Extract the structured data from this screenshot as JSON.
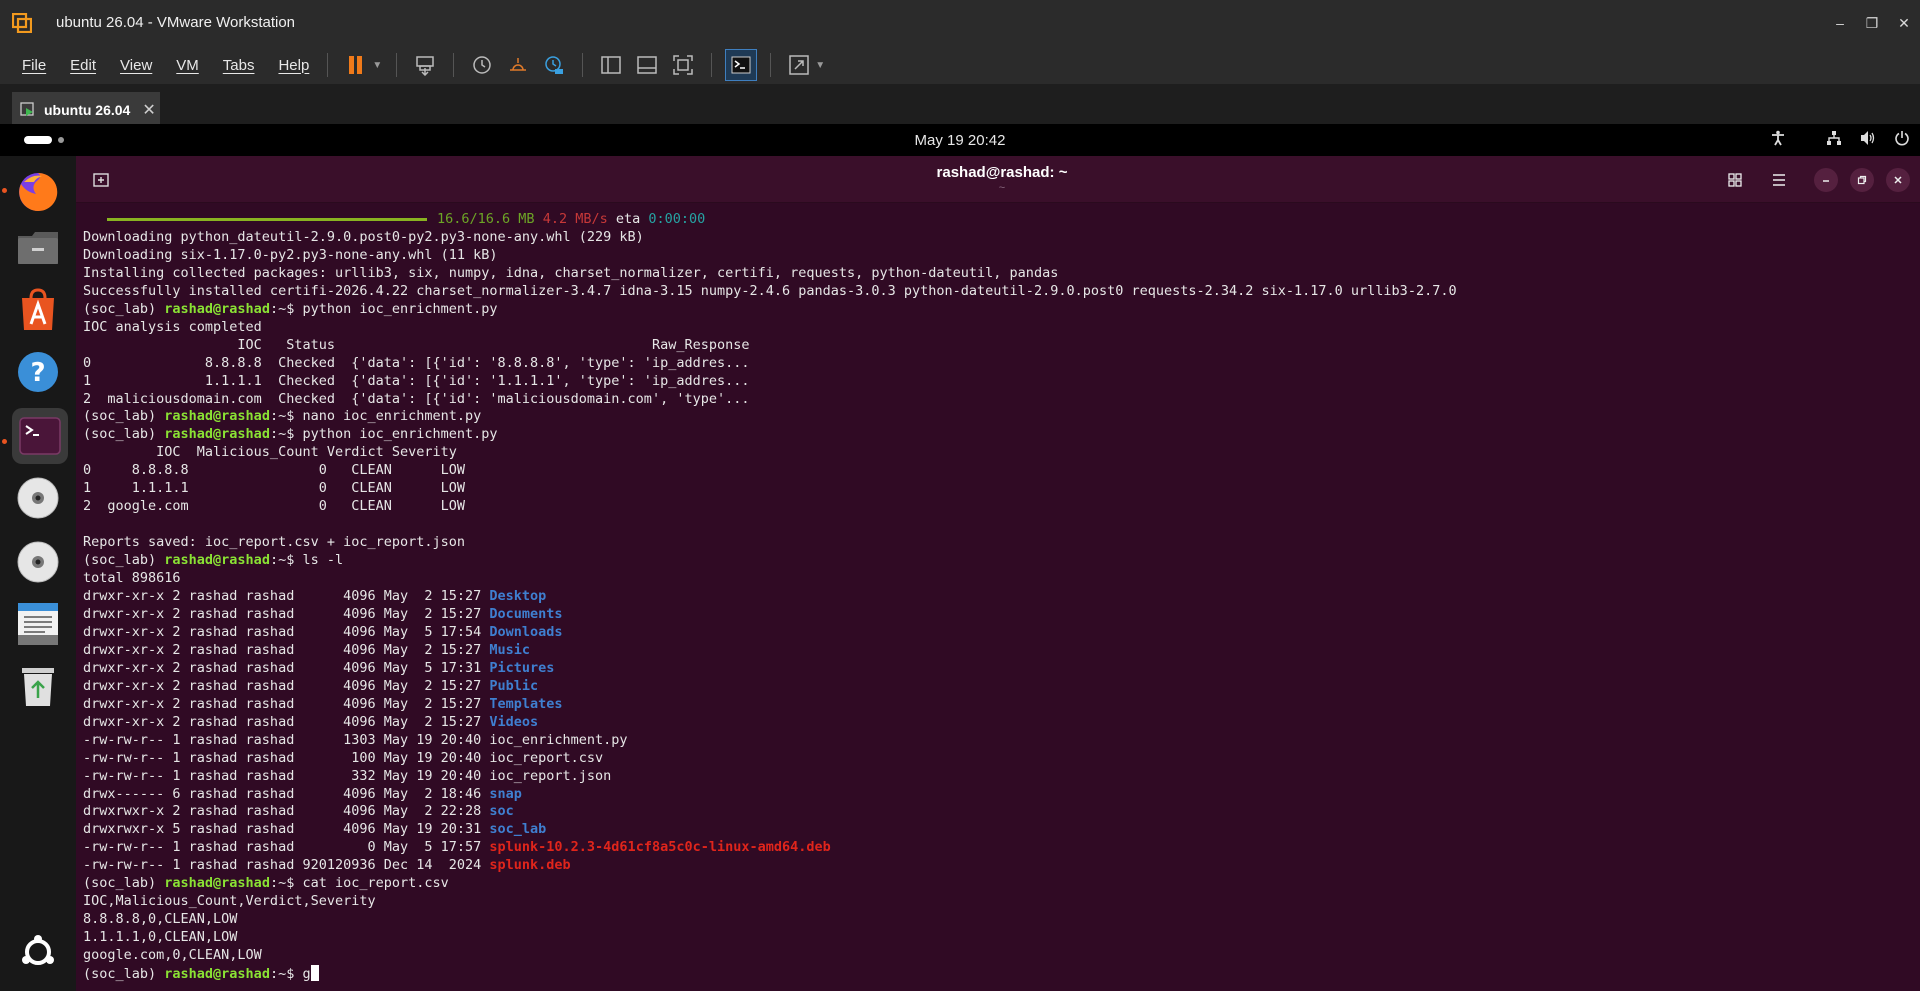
{
  "window": {
    "title": "ubuntu 26.04 - VMware Workstation",
    "controls": [
      "–",
      "❐",
      "✕"
    ]
  },
  "menu": [
    "File",
    "Edit",
    "View",
    "VM",
    "Tabs",
    "Help"
  ],
  "vm_tab": {
    "label": "ubuntu 26.04",
    "close": "✕"
  },
  "panel": {
    "clock": "May 19  20:42"
  },
  "terminal": {
    "title": "rashad@rashad: ~",
    "subtitle": "~",
    "progress": {
      "size": "16.6/16.6 MB",
      "speed": "4.2 MB/s",
      "eta_label": "eta",
      "eta": "0:00:00",
      "fraction": 1.0
    },
    "prompt": {
      "env": "(soc_lab) ",
      "user": "rashad@rashad",
      "path": ":~$ "
    },
    "lines": {
      "l1": "Downloading python_dateutil-2.9.0.post0-py2.py3-none-any.whl (229 kB)",
      "l2": "Downloading six-1.17.0-py2.py3-none-any.whl (11 kB)",
      "l3": "Installing collected packages: urllib3, six, numpy, idna, charset_normalizer, certifi, requests, python-dateutil, pandas",
      "l4": "Successfully installed certifi-2026.4.22 charset_normalizer-3.4.7 idna-3.15 numpy-2.4.6 pandas-3.0.3 python-dateutil-2.9.0.post0 requests-2.34.2 six-1.17.0 urllib3-2.7.0",
      "cmd1": "python ioc_enrichment.py",
      "l6": "IOC analysis completed",
      "l7": "                   IOC   Status                                       Raw_Response",
      "l8": "0              8.8.8.8  Checked  {'data': [{'id': '8.8.8.8', 'type': 'ip_addres...",
      "l9": "1              1.1.1.1  Checked  {'data': [{'id': '1.1.1.1', 'type': 'ip_addres...",
      "l10": "2  maliciousdomain.com  Checked  {'data': [{'id': 'maliciousdomain.com', 'type'...",
      "cmd2": "nano ioc_enrichment.py",
      "cmd3": "python ioc_enrichment.py",
      "l13": "         IOC  Malicious_Count Verdict Severity",
      "l14": "0     8.8.8.8                0   CLEAN      LOW",
      "l15": "1     1.1.1.1                0   CLEAN      LOW",
      "l16": "2  google.com                0   CLEAN      LOW",
      "l18": "Reports saved: ioc_report.csv + ioc_report.json",
      "cmd4": "ls -l",
      "l20": "total 898616",
      "cmd5": "cat ioc_report.csv",
      "c1": "IOC,Malicious_Count,Verdict,Severity",
      "c2": "8.8.8.8,0,CLEAN,LOW",
      "c3": "1.1.1.1,0,CLEAN,LOW",
      "c4": "google.com,0,CLEAN,LOW",
      "typed": "g"
    },
    "ls": [
      {
        "meta": "drwxr-xr-x 2 rashad rashad      4096 May  2 15:27 ",
        "name": "Desktop",
        "kind": "dir"
      },
      {
        "meta": "drwxr-xr-x 2 rashad rashad      4096 May  2 15:27 ",
        "name": "Documents",
        "kind": "dir"
      },
      {
        "meta": "drwxr-xr-x 2 rashad rashad      4096 May  5 17:54 ",
        "name": "Downloads",
        "kind": "dir"
      },
      {
        "meta": "drwxr-xr-x 2 rashad rashad      4096 May  2 15:27 ",
        "name": "Music",
        "kind": "dir"
      },
      {
        "meta": "drwxr-xr-x 2 rashad rashad      4096 May  5 17:31 ",
        "name": "Pictures",
        "kind": "dir"
      },
      {
        "meta": "drwxr-xr-x 2 rashad rashad      4096 May  2 15:27 ",
        "name": "Public",
        "kind": "dir"
      },
      {
        "meta": "drwxr-xr-x 2 rashad rashad      4096 May  2 15:27 ",
        "name": "Templates",
        "kind": "dir"
      },
      {
        "meta": "drwxr-xr-x 2 rashad rashad      4096 May  2 15:27 ",
        "name": "Videos",
        "kind": "dir"
      },
      {
        "meta": "-rw-rw-r-- 1 rashad rashad      1303 May 19 20:40 ",
        "name": "ioc_enrichment.py",
        "kind": "file"
      },
      {
        "meta": "-rw-rw-r-- 1 rashad rashad       100 May 19 20:40 ",
        "name": "ioc_report.csv",
        "kind": "file"
      },
      {
        "meta": "-rw-rw-r-- 1 rashad rashad       332 May 19 20:40 ",
        "name": "ioc_report.json",
        "kind": "file"
      },
      {
        "meta": "drwx------ 6 rashad rashad      4096 May  2 18:46 ",
        "name": "snap",
        "kind": "dir"
      },
      {
        "meta": "drwxrwxr-x 2 rashad rashad      4096 May  2 22:28 ",
        "name": "soc",
        "kind": "dir"
      },
      {
        "meta": "drwxrwxr-x 5 rashad rashad      4096 May 19 20:31 ",
        "name": "soc_lab",
        "kind": "dir"
      },
      {
        "meta": "-rw-rw-r-- 1 rashad rashad         0 May  5 17:57 ",
        "name": "splunk-10.2.3-4d61cf8a5c0c-linux-amd64.deb",
        "kind": "deb"
      },
      {
        "meta": "-rw-rw-r-- 1 rashad rashad 920120936 Dec 14  2024 ",
        "name": "splunk.deb",
        "kind": "deb"
      }
    ]
  },
  "dock": [
    "firefox-icon",
    "files-icon",
    "app-center-icon",
    "help-icon",
    "terminal-icon",
    "disc-icon",
    "disc-icon",
    "text-editor-icon",
    "trash-icon",
    "show-apps-icon"
  ],
  "colors": {
    "terminal_bg": "#300a24",
    "prompt_green": "#8ae234",
    "dir_blue": "#3f7fd0",
    "deb_red": "#e0251b",
    "ubuntu_orange": "#e95420"
  }
}
